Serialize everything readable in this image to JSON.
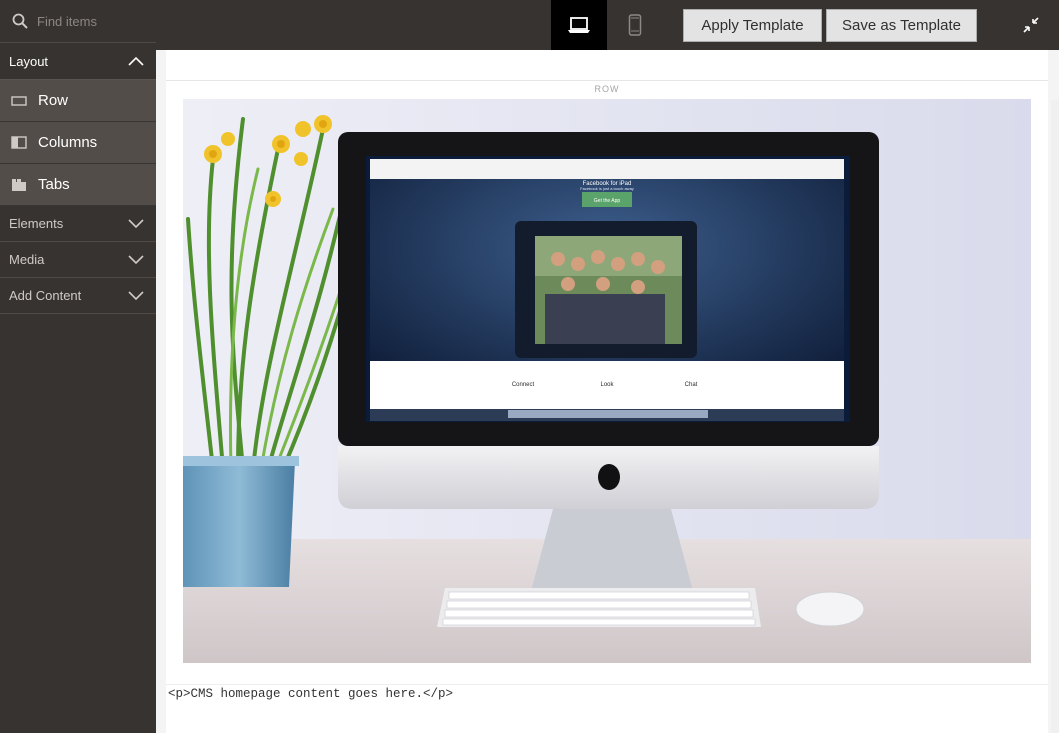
{
  "sidebar": {
    "search_placeholder": "Find items",
    "groups": [
      {
        "label": "Layout",
        "expanded": true
      },
      {
        "label": "Elements",
        "expanded": false
      },
      {
        "label": "Media",
        "expanded": false
      },
      {
        "label": "Add Content",
        "expanded": false
      }
    ],
    "layout_items": [
      {
        "label": "Row",
        "icon": "row-icon"
      },
      {
        "label": "Columns",
        "icon": "columns-icon"
      },
      {
        "label": "Tabs",
        "icon": "tabs-icon"
      }
    ]
  },
  "toolbar": {
    "views": [
      {
        "name": "desktop-view",
        "icon": "laptop-icon",
        "active": true
      },
      {
        "name": "mobile-view",
        "icon": "phone-icon",
        "active": false
      }
    ],
    "apply_template_label": "Apply Template",
    "save_template_label": "Save as Template"
  },
  "stage": {
    "row_label": "ROW",
    "html_code": "<p>CMS homepage content goes here.</p>"
  },
  "hero_image": {
    "screen": {
      "headline": "Facebook for iPad",
      "subhead": "Facebook is just a touch away",
      "cta": "Get the App",
      "features": [
        "Connect",
        "Look",
        "Chat"
      ]
    }
  },
  "colors": {
    "sidebar_bg": "#373330",
    "sidebar_item_bg": "#524d49",
    "active_view_bg": "#000000",
    "button_bg": "#e3e3e3"
  }
}
